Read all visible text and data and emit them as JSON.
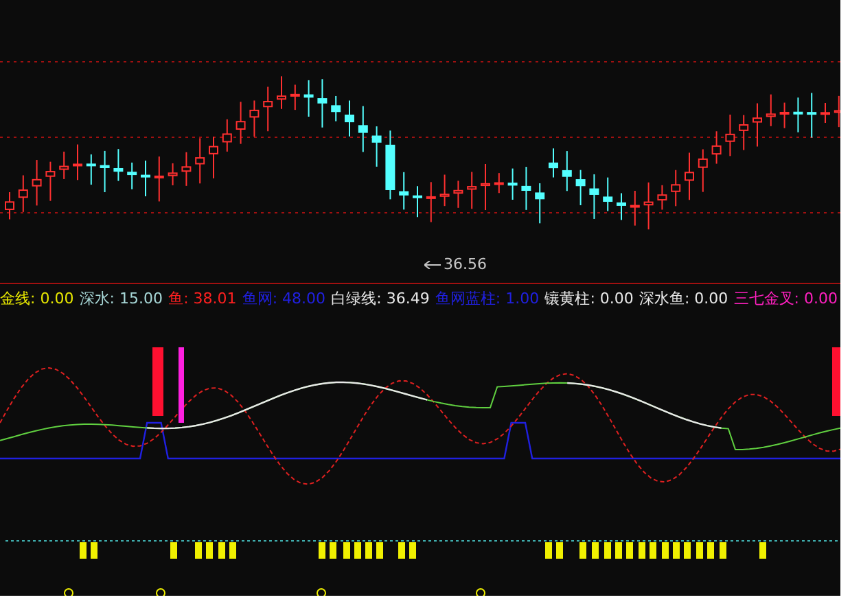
{
  "price_label": "36.56",
  "legend": [
    {
      "text": "金线: 0.00",
      "color": "#e8e800"
    },
    {
      "text": "深水: 15.00",
      "color": "#a8d8d8"
    },
    {
      "text": "鱼: 38.01",
      "color": "#ff2020"
    },
    {
      "text": "鱼网: 48.00",
      "color": "#2020e0"
    },
    {
      "text": "白绿线: 36.49",
      "color": "#e8e8e8"
    },
    {
      "text": "鱼网蓝柱: 1.00",
      "color": "#2020e0"
    },
    {
      "text": "镶黄柱: 0.00",
      "color": "#e8e8e8"
    },
    {
      "text": "深水鱼: 0.00",
      "color": "#e8e8e8"
    },
    {
      "text": "三七金叉: 0.00",
      "color": "#ff20c0"
    }
  ]
}
